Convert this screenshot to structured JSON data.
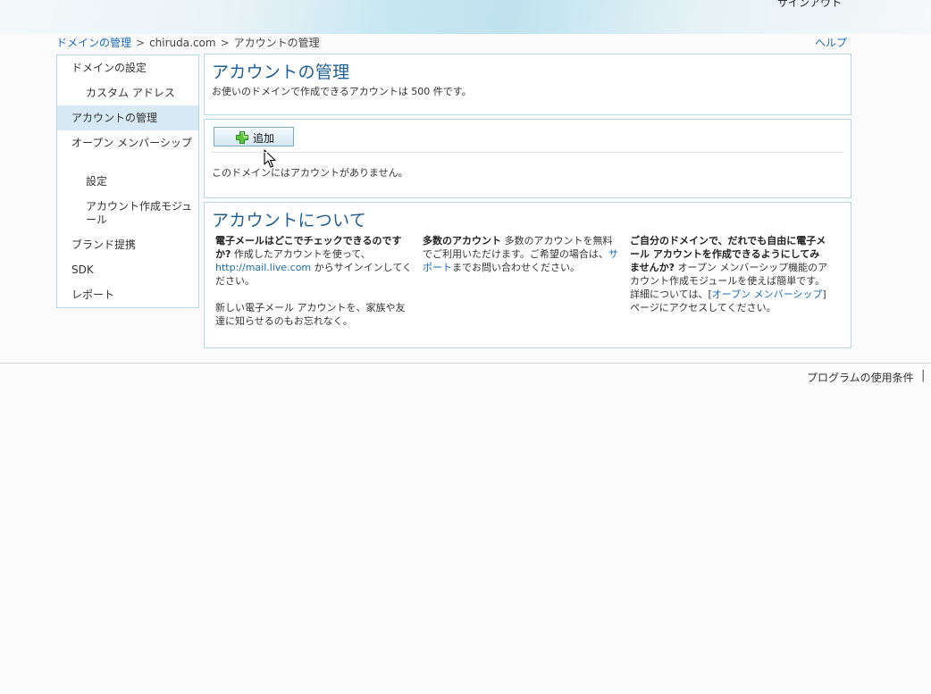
{
  "header": {
    "signout": "サインアウト"
  },
  "breadcrumb": {
    "root": "ドメインの管理",
    "sep": ">",
    "domain": "chiruda.com",
    "current": "アカウントの管理",
    "help": "ヘルプ"
  },
  "sidebar": {
    "items": [
      {
        "label": "ドメインの設定"
      },
      {
        "label": "カスタム アドレス"
      },
      {
        "label": "アカウントの管理"
      },
      {
        "label": "オープン メンバーシップ"
      },
      {
        "label": "設定"
      },
      {
        "label": "アカウント作成モジュール"
      },
      {
        "label": "ブランド提携"
      },
      {
        "label": "SDK"
      },
      {
        "label": "レポート"
      }
    ]
  },
  "account_panel": {
    "title": "アカウントの管理",
    "desc": "お使いのドメインで作成できるアカウントは 500 件です。"
  },
  "add_panel": {
    "add_label": "追加",
    "empty_msg": "このドメインにはアカウントがありません。"
  },
  "about": {
    "title": "アカウントについて",
    "col1": {
      "bold": "電子メールはどこでチェックできるのですか?",
      "text1": " 作成したアカウントを使って、",
      "link": "http://mail.live.com",
      "text2": " からサインインしてください。",
      "para2": "新しい電子メール アカウントを、家族や友達に知らせるのもお忘れなく。"
    },
    "col2": {
      "bold": "多数のアカウント",
      "text1": " 多数のアカウントを無料でご利用いただけます。ご希望の場合は、",
      "link": "サポート",
      "text2": "までお問い合わせください。"
    },
    "col3": {
      "bold": "ご自分のドメインで、だれでも自由に電子メール アカウントを作成できるようにしてみませんか?",
      "text1": " オープン メンバーシップ機能のアカウント作成モジュールを使えば簡単です。詳細については、[",
      "link": "オープン メンバーシップ",
      "text2": "] ページにアクセスしてください。"
    }
  },
  "footer": {
    "terms": "プログラムの使用条件",
    "sep": "|"
  }
}
